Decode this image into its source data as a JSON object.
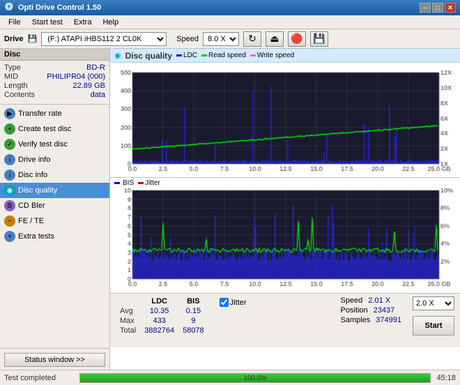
{
  "titleBar": {
    "title": "Opti Drive Control 1.50",
    "minBtn": "─",
    "maxBtn": "□",
    "closeBtn": "✕"
  },
  "menuBar": {
    "items": [
      "File",
      "Start test",
      "Extra",
      "Help"
    ]
  },
  "driveBar": {
    "driveLabel": "Drive",
    "driveValue": "(F:)  ATAPI iHBS112  2 CL0K",
    "speedLabel": "Speed",
    "speedValue": "8.0 X"
  },
  "disc": {
    "sectionTitle": "Disc",
    "fields": [
      {
        "label": "Type",
        "value": "BD-R"
      },
      {
        "label": "MID",
        "value": "PHILIPR04 (000)"
      },
      {
        "label": "Length",
        "value": "22.89 GB"
      },
      {
        "label": "Contents",
        "value": "data"
      }
    ]
  },
  "sidebarButtons": [
    {
      "id": "transfer-rate",
      "label": "Transfer rate",
      "color": "btn-blue"
    },
    {
      "id": "create-test-disc",
      "label": "Create test disc",
      "color": "btn-green"
    },
    {
      "id": "verify-test-disc",
      "label": "Verify test disc",
      "color": "btn-green"
    },
    {
      "id": "drive-info",
      "label": "Drive info",
      "color": "btn-blue"
    },
    {
      "id": "disc-info",
      "label": "Disc info",
      "color": "btn-blue"
    },
    {
      "id": "disc-quality",
      "label": "Disc quality",
      "color": "btn-cyan",
      "active": true
    },
    {
      "id": "cd-bler",
      "label": "CD Bler",
      "color": "btn-purple"
    },
    {
      "id": "fe-te",
      "label": "FE / TE",
      "color": "btn-orange"
    },
    {
      "id": "extra-tests",
      "label": "Extra tests",
      "color": "btn-blue"
    }
  ],
  "statusWindowBtn": "Status window >>",
  "chartHeader": {
    "title": "Disc quality",
    "legendLDC": "LDC",
    "legendRead": "Read speed",
    "legendWrite": "Write speed"
  },
  "bisHeader": {
    "legendBIS": "BIS",
    "legendJitter": "Jitter"
  },
  "topChart": {
    "yAxisMax": 500,
    "yAxisLabels": [
      "500",
      "400",
      "300",
      "200",
      "100",
      "0"
    ],
    "yAxisRight": [
      "12X",
      "10X",
      "8X",
      "6X",
      "4X",
      "2X",
      "1X"
    ],
    "xAxisLabels": [
      "0.0",
      "2.5",
      "5.0",
      "7.5",
      "10.0",
      "12.5",
      "15.0",
      "17.5",
      "20.0",
      "22.5",
      "25.0 GB"
    ]
  },
  "bottomChart": {
    "yAxisMax": 10,
    "yAxisLabels": [
      "10",
      "9",
      "8",
      "7",
      "6",
      "5",
      "4",
      "3",
      "2",
      "1"
    ],
    "yAxisRight": [
      "10%",
      "8%",
      "6%",
      "4%",
      "2%"
    ],
    "xAxisLabels": [
      "0.0",
      "2.5",
      "5.0",
      "7.5",
      "10.0",
      "12.5",
      "15.0",
      "17.5",
      "20.0",
      "22.5",
      "25.0 GB"
    ]
  },
  "stats": {
    "headers": [
      "LDC",
      "BIS"
    ],
    "rows": [
      {
        "label": "Avg",
        "ldc": "10.35",
        "bis": "0.15"
      },
      {
        "label": "Max",
        "ldc": "433",
        "bis": "9"
      },
      {
        "label": "Total",
        "ldc": "3882764",
        "bis": "58078"
      }
    ],
    "jitterLabel": "Jitter",
    "jitterChecked": true,
    "speedLabel": "Speed",
    "speedValue": "2.01 X",
    "speedSelect": "2.0 X",
    "positionLabel": "Position",
    "positionValue": "23437",
    "samplesLabel": "Samples",
    "samplesValue": "374991",
    "startBtn": "Start"
  },
  "statusBar": {
    "text": "Test completed",
    "progress": "100.0%",
    "progressValue": 100,
    "time": "45:18"
  }
}
